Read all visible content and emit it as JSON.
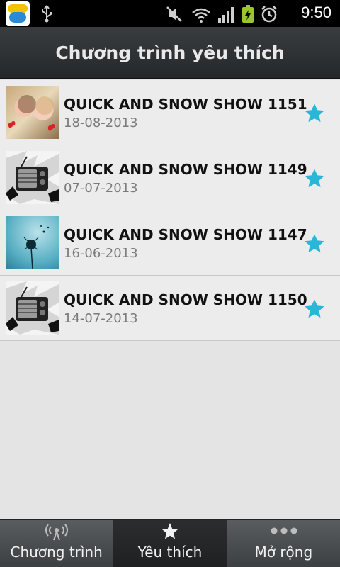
{
  "status_bar": {
    "time": "9:50",
    "icons": [
      "app-icon",
      "usb-icon",
      "mute-icon",
      "wifi-icon",
      "signal-icon",
      "battery-charging-icon",
      "alarm-icon"
    ]
  },
  "header": {
    "title": "Chương trình yêu thích"
  },
  "favorites": [
    {
      "title": "QUICK AND SNOW SHOW 1151",
      "date": "18-08-2013",
      "thumbnail": "kids-photo",
      "favorite": true
    },
    {
      "title": "QUICK AND SNOW SHOW 1149",
      "date": "07-07-2013",
      "thumbnail": "radio-illustration",
      "favorite": true
    },
    {
      "title": "QUICK AND SNOW SHOW 1147",
      "date": "16-06-2013",
      "thumbnail": "dandelion-photo",
      "favorite": true
    },
    {
      "title": "QUICK AND SNOW SHOW 1150",
      "date": "14-07-2013",
      "thumbnail": "radio-illustration",
      "favorite": true
    }
  ],
  "bottom_nav": {
    "tabs": [
      {
        "label": "Chương trình",
        "icon": "broadcast-icon",
        "active": false
      },
      {
        "label": "Yêu thích",
        "icon": "star-icon",
        "active": true
      },
      {
        "label": "Mở rộng",
        "icon": "more-dots-icon",
        "active": false
      }
    ]
  },
  "colors": {
    "star": "#29b6d8",
    "title_bar": "#2f3235",
    "list_bg": "#ececec",
    "page_bg": "#e4e4e4"
  }
}
